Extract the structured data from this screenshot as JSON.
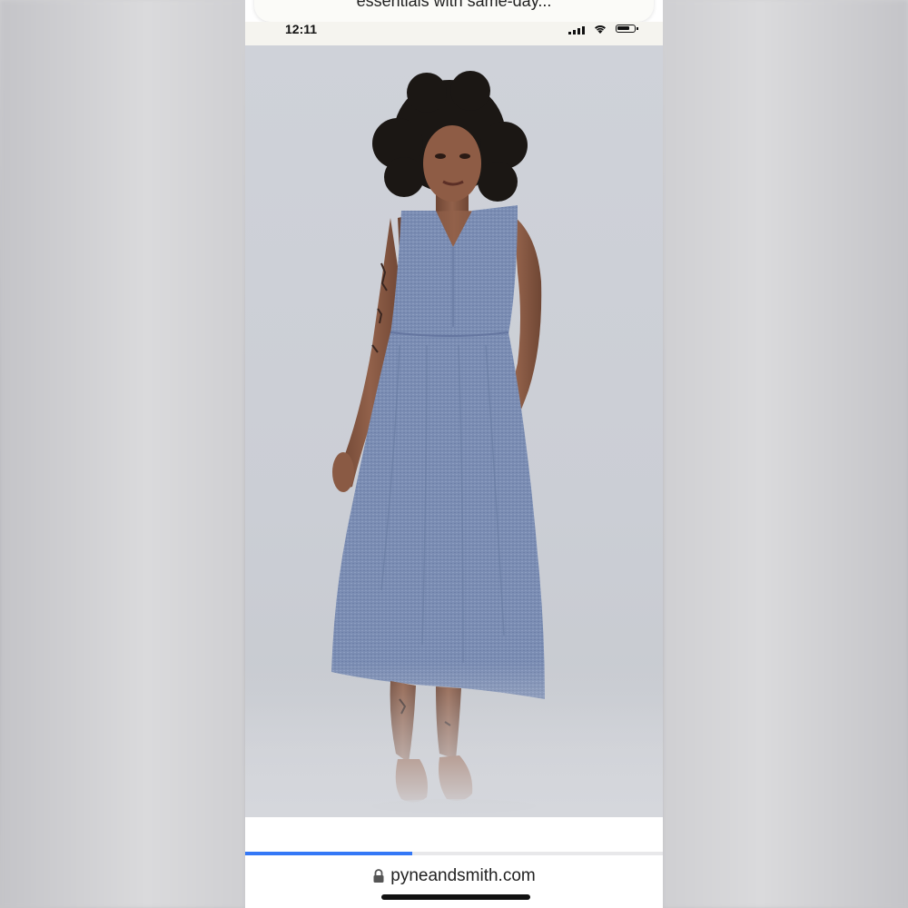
{
  "notification": {
    "text": "essentials with same-day..."
  },
  "status_bar": {
    "time": "12:11",
    "icons": [
      "signal-icon",
      "wifi-icon",
      "battery-icon"
    ]
  },
  "photo": {
    "subject": "person-in-sleeveless-dress",
    "colors": {
      "background": "#cdd0d7",
      "dress": "#7a8cb2",
      "shoes": "#8b4a2b",
      "hair": "#1b1714",
      "skin": "#8a5a44"
    }
  },
  "browser": {
    "url": "pyneandsmith.com",
    "lock_icon": "lock-icon",
    "load_progress": 0.4,
    "accent": "#3478f6"
  }
}
